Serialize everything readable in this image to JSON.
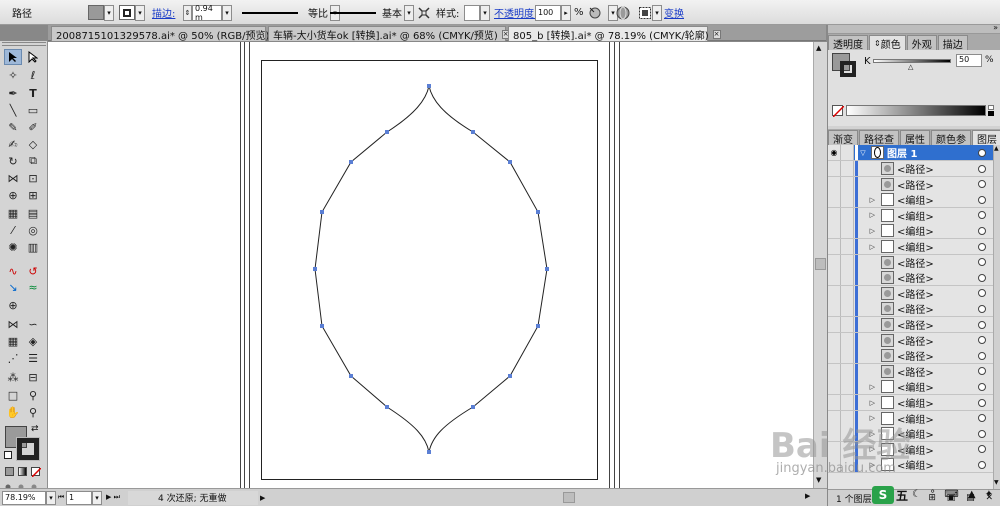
{
  "control_bar": {
    "selection_label": "路径",
    "stroke_label": "描边:",
    "stroke_weight": "0.94 m",
    "profile_1": "等比",
    "profile_2": "基本",
    "style_label": "样式:",
    "opacity_label": "不透明度:",
    "opacity_value": "100",
    "percent": "%",
    "transform_link": "变换"
  },
  "doc_tabs": [
    {
      "label": "2008715101329578.ai* @ 50% (RGB/预览)",
      "close": "×"
    },
    {
      "label": "车辆-大小货车ok [转换].ai* @ 68% (CMYK/预览)",
      "close": "×"
    },
    {
      "label": "805_b [转换].ai* @ 78.19% (CMYK/轮廓)",
      "close": "×"
    }
  ],
  "color_panel": {
    "tabs": [
      "透明度",
      "颜色",
      "外观",
      "描边"
    ],
    "channel_label": "K",
    "k_value": "50",
    "percent": "%"
  },
  "layers_panel": {
    "tabs": [
      "渐变",
      "路径查",
      "属性",
      "颜色参",
      "图层"
    ],
    "layer_name": "图层 1",
    "items": [
      "<路径>",
      "<路径>",
      "<编组>",
      "<编组>",
      "<编组>",
      "<编组>",
      "<路径>",
      "<路径>",
      "<路径>",
      "<路径>",
      "<路径>",
      "<路径>",
      "<路径>",
      "<路径>",
      "<编组>",
      "<编组>",
      "<编组>",
      "<编组>",
      "<编组>",
      "<编组>"
    ],
    "footer_text": "1 个图层"
  },
  "status_bar": {
    "zoom": "78.19%",
    "artboard": "1",
    "undo_info": "4 次还原; 无重做"
  },
  "watermark": {
    "brand": "Bai 经验",
    "url": "jingyan.baidu.com"
  },
  "ime_bar": {
    "label": "五"
  }
}
